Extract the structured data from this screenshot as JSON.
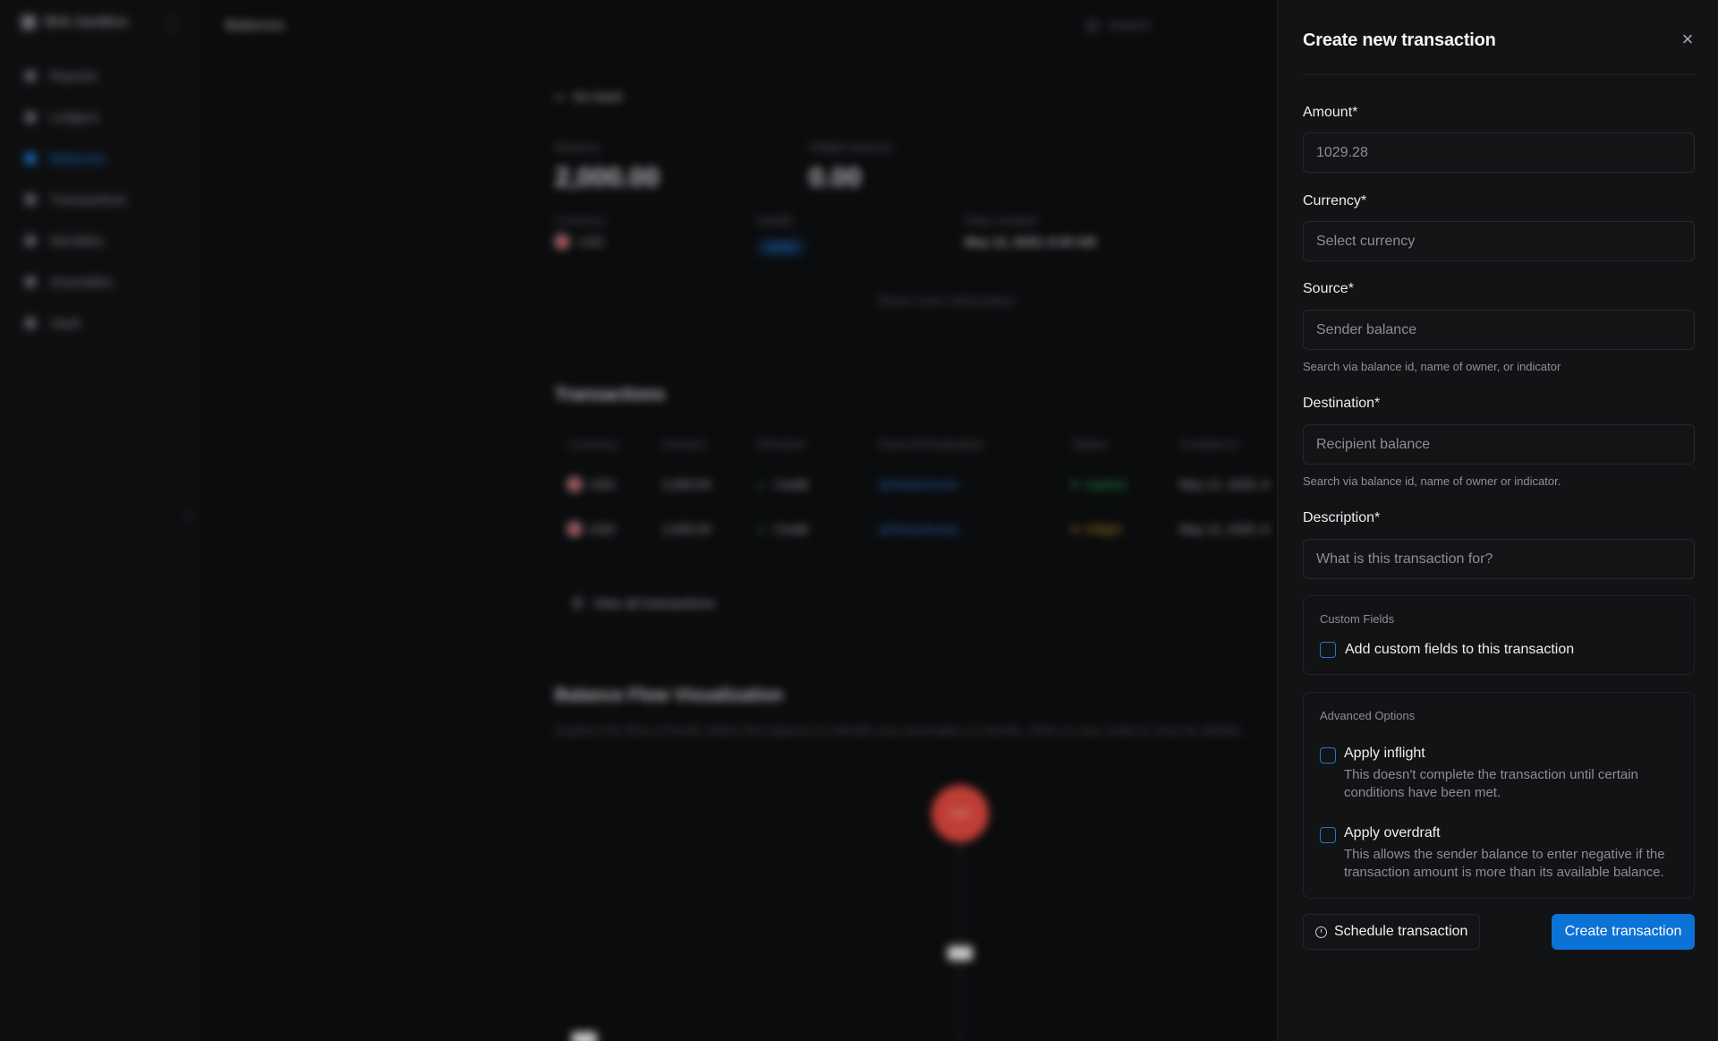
{
  "app": {
    "workspace": "Blnk Sandbox",
    "breadcrumb": "Balances",
    "search_label": "Search",
    "sidebar_items": [
      "Reports",
      "Ledgers",
      "Balances",
      "Transactions",
      "Identities",
      "Anomalies",
      "Vault"
    ],
    "active_item": "Balances"
  },
  "balance": {
    "back_label": "Go back",
    "balance_label": "Balance",
    "balance_value": "2,000.00",
    "inflight_label": "Inflight balance",
    "inflight_value": "0.00",
    "currency_label": "Currency",
    "currency_value": "USD",
    "health_label": "Health",
    "health_value": "Stable",
    "date_label": "Date created",
    "date_value": "May 12, 2025, 8:40 AM",
    "show_more": "Show more information"
  },
  "transactions": {
    "title": "Transactions",
    "columns": [
      "Currency",
      "Amount",
      "Direction",
      "Source/Destination",
      "Status",
      "Created At"
    ],
    "rows": [
      {
        "currency": "USD",
        "amount": "2,000.00",
        "direction": "Credit",
        "source": "@Stripe/funds",
        "status": "Applied",
        "created": "May 12, 2025, 8"
      },
      {
        "currency": "USD",
        "amount": "2,000.00",
        "direction": "Credit",
        "source": "@Stripe/funds",
        "status": "Inflight",
        "created": "May 12, 2025, 8"
      }
    ],
    "view_all": "View all transactions"
  },
  "visualization": {
    "title": "Balance Flow Visualization",
    "description": "Explore the flow of funds within the balance to identify any anomalies or trends. Click on any node to view its details.",
    "node_label": "Start"
  },
  "panel": {
    "title": "Create new transaction",
    "amount_label": "Amount*",
    "amount_value": "1029.28",
    "currency_label": "Currency*",
    "currency_placeholder": "Select currency",
    "source_label": "Source*",
    "source_placeholder": "Sender balance",
    "source_hint": "Search via balance id, name of owner, or indicator",
    "destination_label": "Destination*",
    "destination_placeholder": "Recipient balance",
    "destination_hint": "Search via balance id, name of owner or indicator.",
    "description_label": "Description*",
    "description_placeholder": "What is this transaction for?",
    "custom_fields_title": "Custom Fields",
    "custom_fields_checkbox": "Add custom fields to this transaction",
    "advanced_title": "Advanced Options",
    "inflight_label": "Apply inflight",
    "inflight_desc": "This doesn't complete the transaction until certain conditions have been met.",
    "overdraft_label": "Apply overdraft",
    "overdraft_desc": "This allows the sender balance to enter negative if the transaction amount is more than its available balance.",
    "schedule_button": "Schedule transaction",
    "create_button": "Create transaction"
  },
  "colors": {
    "accent": "#0b72d6",
    "panel_bg": "#121315",
    "app_bg": "#0d0e10",
    "node_red": "#d9473c"
  }
}
